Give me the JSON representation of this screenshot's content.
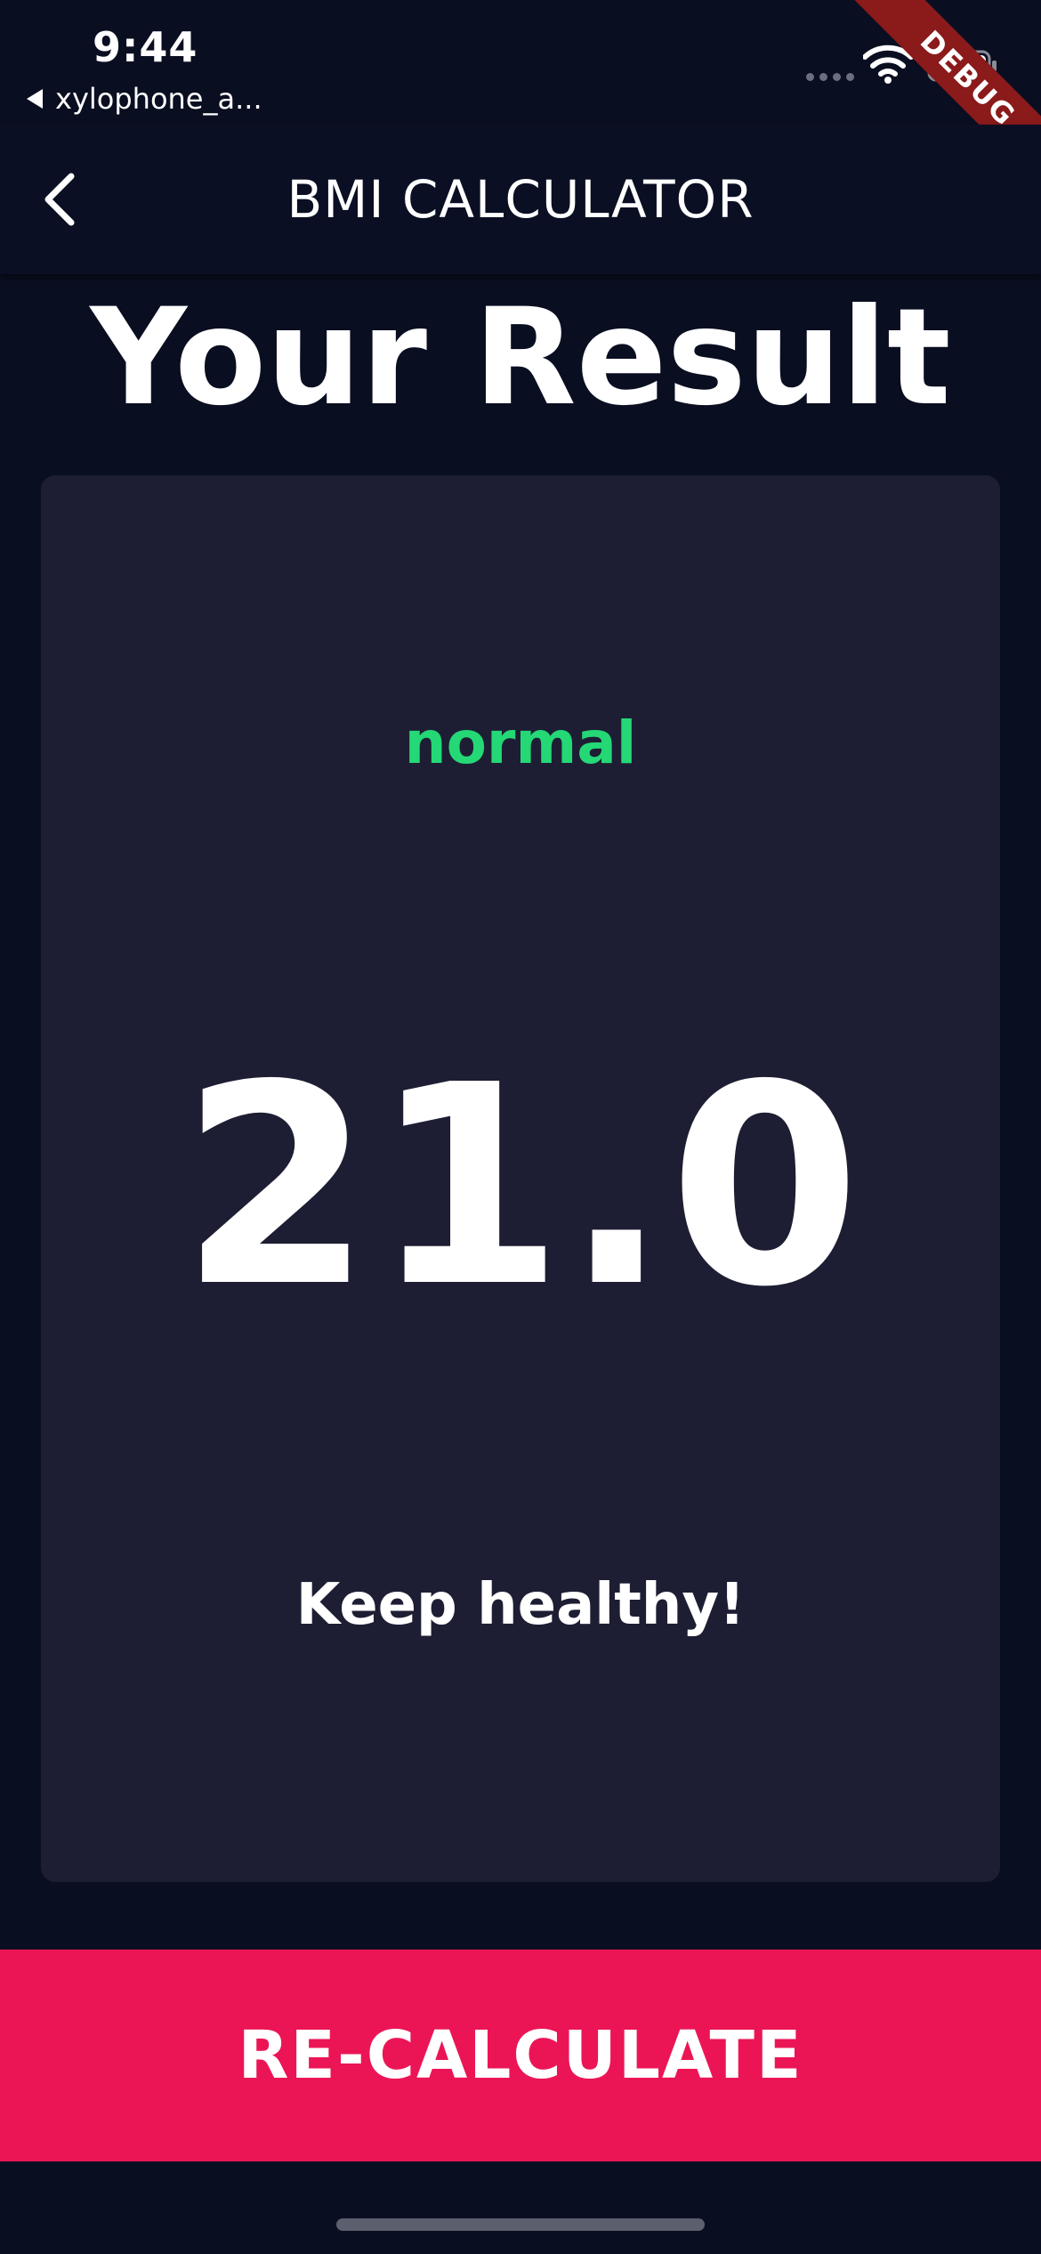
{
  "status_bar": {
    "time": "9:44",
    "back_app_label": "xylophone_a..."
  },
  "debug_banner": "DEBUG",
  "app_bar": {
    "title": "BMI CALCULATOR"
  },
  "result": {
    "heading": "Your Result",
    "status": "normal",
    "bmi_value": "21.0",
    "message": "Keep healthy!"
  },
  "recalculate_button": {
    "label": "RE-CALCULATE"
  },
  "colors": {
    "background": "#0a0e21",
    "card": "#1d1e33",
    "status_green": "#24d876",
    "button_accent": "#eb1555"
  },
  "icons": {
    "app_back": "chevron-left-icon",
    "status_back": "back-triangle-icon",
    "wifi": "wifi-icon",
    "battery": "battery-icon"
  }
}
